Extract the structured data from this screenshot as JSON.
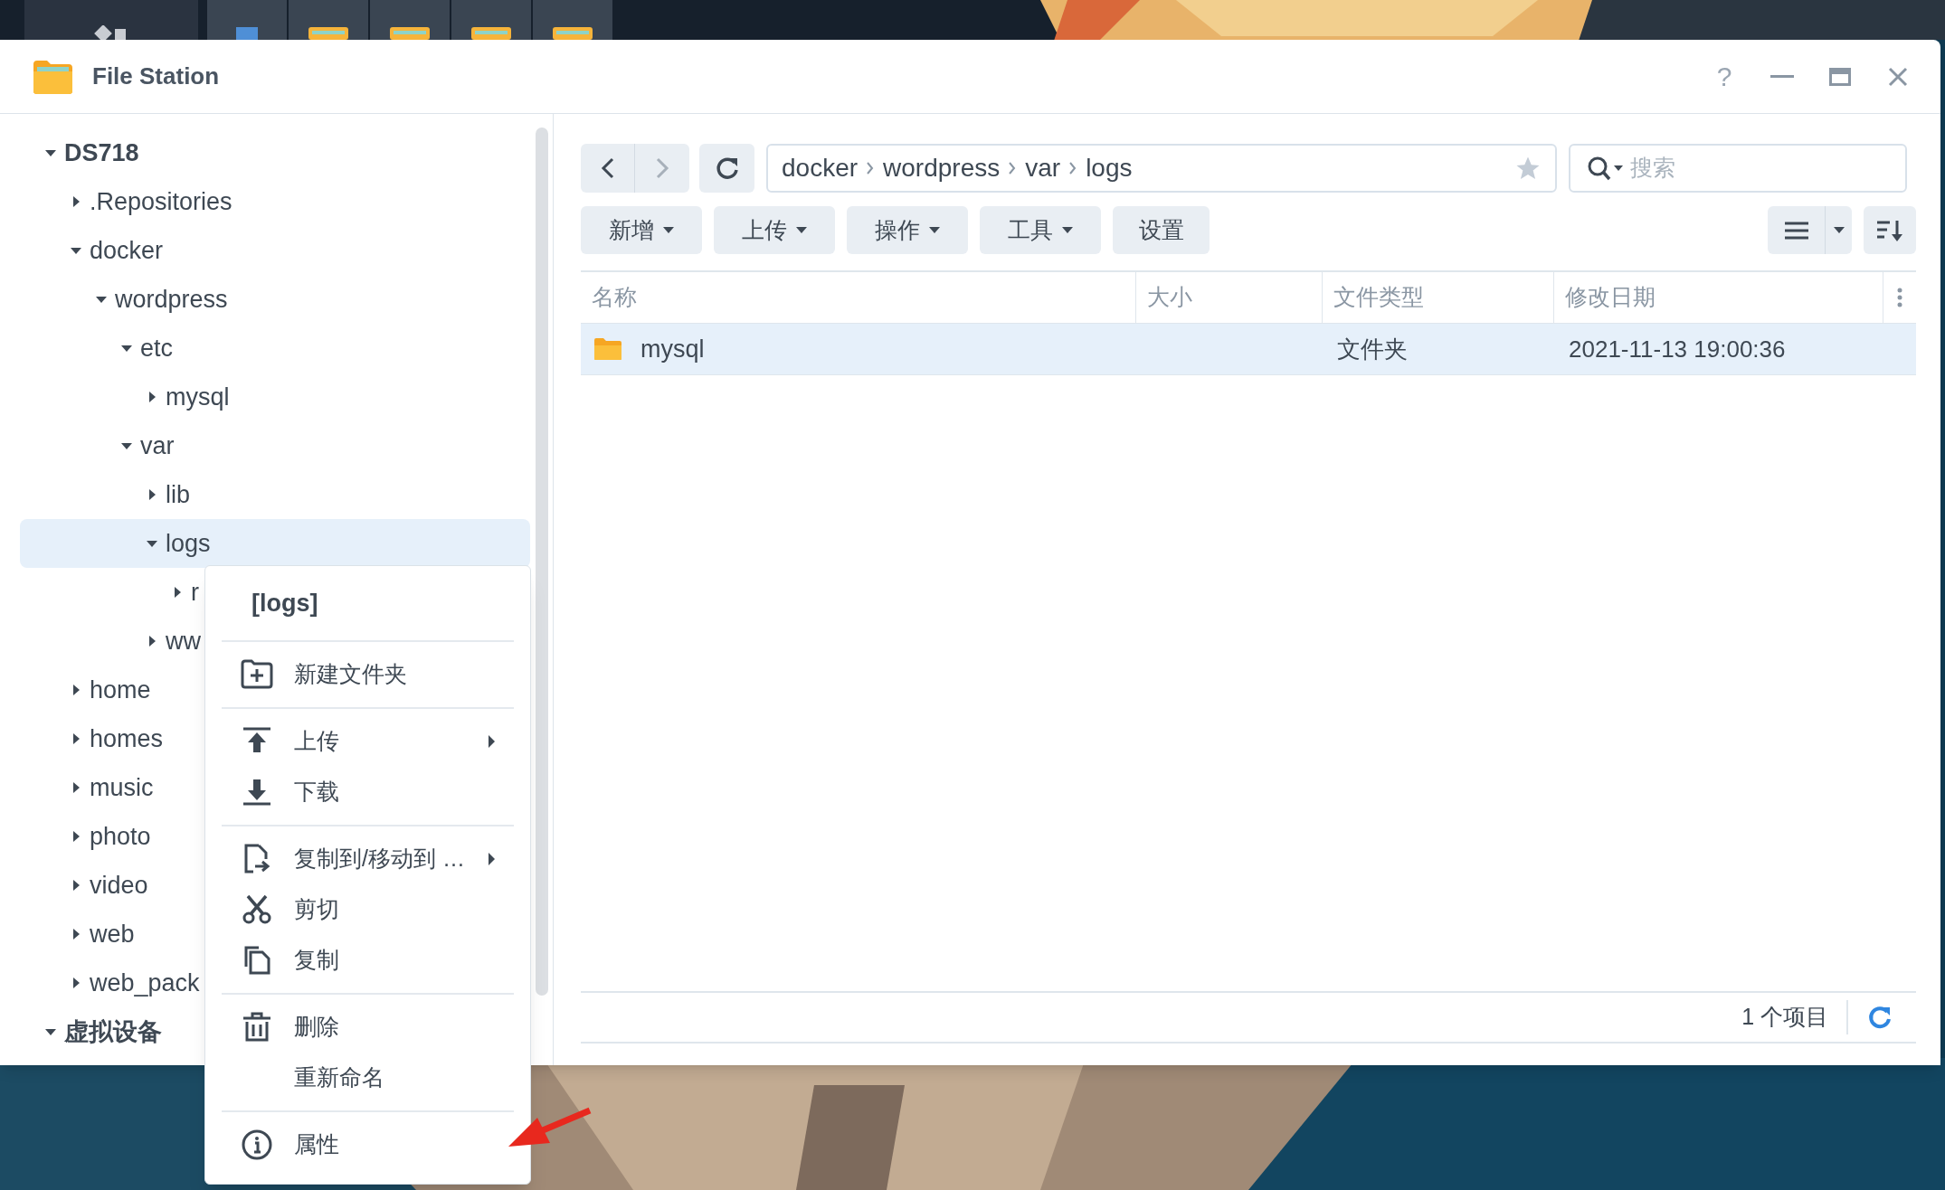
{
  "window": {
    "title": "File Station",
    "help_glyph": "?"
  },
  "tree": [
    {
      "label": "DS718",
      "expanded": true,
      "selected": false,
      "children": [
        {
          "label": ".Repositories",
          "expanded": false,
          "selected": false
        },
        {
          "label": "docker",
          "expanded": true,
          "selected": false,
          "children": [
            {
              "label": "wordpress",
              "expanded": true,
              "selected": false,
              "children": [
                {
                  "label": "etc",
                  "expanded": true,
                  "selected": false,
                  "children": [
                    {
                      "label": "mysql",
                      "expanded": false,
                      "selected": false
                    }
                  ]
                },
                {
                  "label": "var",
                  "expanded": true,
                  "selected": false,
                  "children": [
                    {
                      "label": "lib",
                      "expanded": false,
                      "selected": false
                    },
                    {
                      "label": "logs",
                      "expanded": true,
                      "selected": true,
                      "children": [
                        {
                          "label": "r",
                          "expanded": false,
                          "selected": false
                        }
                      ]
                    },
                    {
                      "label": "ww",
                      "expanded": false,
                      "selected": false
                    }
                  ]
                }
              ]
            }
          ]
        },
        {
          "label": "home",
          "expanded": false,
          "selected": false
        },
        {
          "label": "homes",
          "expanded": false,
          "selected": false
        },
        {
          "label": "music",
          "expanded": false,
          "selected": false
        },
        {
          "label": "photo",
          "expanded": false,
          "selected": false
        },
        {
          "label": "video",
          "expanded": false,
          "selected": false
        },
        {
          "label": "web",
          "expanded": false,
          "selected": false
        },
        {
          "label": "web_pack",
          "expanded": false,
          "selected": false
        }
      ]
    },
    {
      "label": "虚拟设备",
      "expanded": true,
      "selected": false
    }
  ],
  "path": [
    "docker",
    "wordpress",
    "var",
    "logs"
  ],
  "search": {
    "placeholder": "搜索"
  },
  "toolbar": [
    {
      "label": "新增",
      "dropdown": true
    },
    {
      "label": "上传",
      "dropdown": true
    },
    {
      "label": "操作",
      "dropdown": true
    },
    {
      "label": "工具",
      "dropdown": true
    },
    {
      "label": "设置",
      "dropdown": false
    }
  ],
  "table": {
    "columns": [
      "名称",
      "大小",
      "文件类型",
      "修改日期"
    ],
    "rows": [
      {
        "name": "mysql",
        "type": "文件夹",
        "modified": "2021-11-13 19:00:36",
        "selected": true
      }
    ]
  },
  "status_bar": {
    "count": "1 个项目"
  },
  "context_menu": {
    "title": "[logs]",
    "groups": [
      [
        {
          "kind": "newfolder",
          "label": "新建文件夹",
          "submenu": false
        }
      ],
      [
        {
          "kind": "upload",
          "label": "上传",
          "submenu": true
        },
        {
          "kind": "download",
          "label": "下载",
          "submenu": false
        }
      ],
      [
        {
          "kind": "copymove",
          "label": "复制到/移动到 …",
          "submenu": true
        },
        {
          "kind": "cut",
          "label": "剪切",
          "submenu": false
        },
        {
          "kind": "copy",
          "label": "复制",
          "submenu": false
        }
      ],
      [
        {
          "kind": "delete",
          "label": "删除",
          "submenu": false
        },
        {
          "kind": "rename",
          "label": "重新命名",
          "submenu": false
        }
      ],
      [
        {
          "kind": "properties",
          "label": "属性",
          "submenu": false
        }
      ]
    ]
  }
}
